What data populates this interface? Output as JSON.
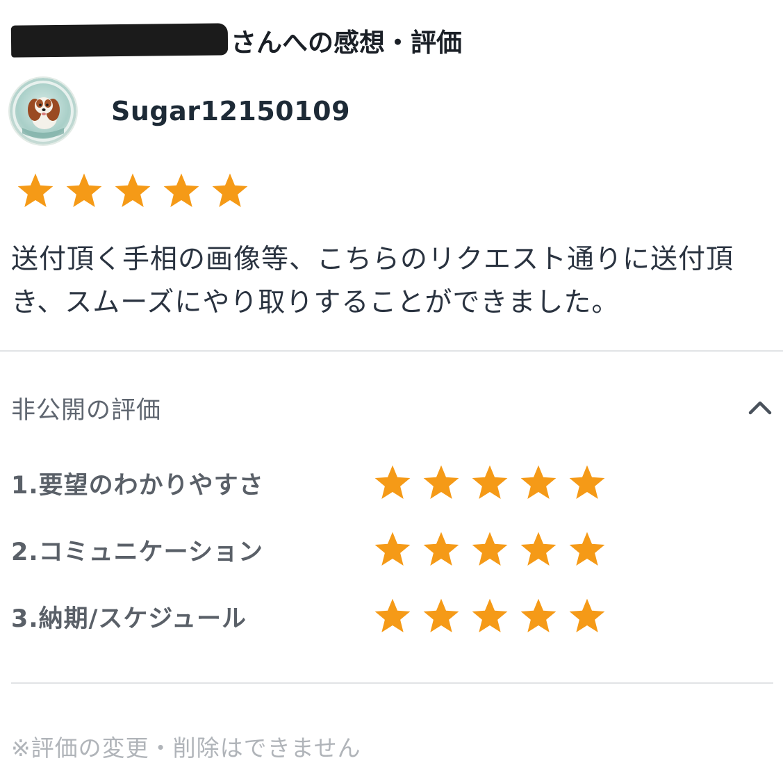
{
  "header": {
    "title_suffix": "さんへの感想・評価"
  },
  "reviewer": {
    "name": "Sugar12150109"
  },
  "review": {
    "overall_rating": 5,
    "max_rating": 5,
    "comment": "送付頂く手相の画像等、こちらのリクエスト通りに送付頂き、スムーズにやり取りすることができました。"
  },
  "private_ratings": {
    "title": "非公開の評価",
    "items": [
      {
        "label": "1.要望のわかりやすさ",
        "rating": 5
      },
      {
        "label": "2.コミュニケーション",
        "rating": 5
      },
      {
        "label": "3.納期/スケジュール",
        "rating": 5
      }
    ]
  },
  "footnote": "※評価の変更・削除はできません",
  "colors": {
    "star": "#f59a17",
    "divider": "#e1e3e6",
    "muted_text": "#5a6068"
  },
  "icons": {
    "collapse": "chevron-up-icon",
    "star": "star-icon"
  }
}
